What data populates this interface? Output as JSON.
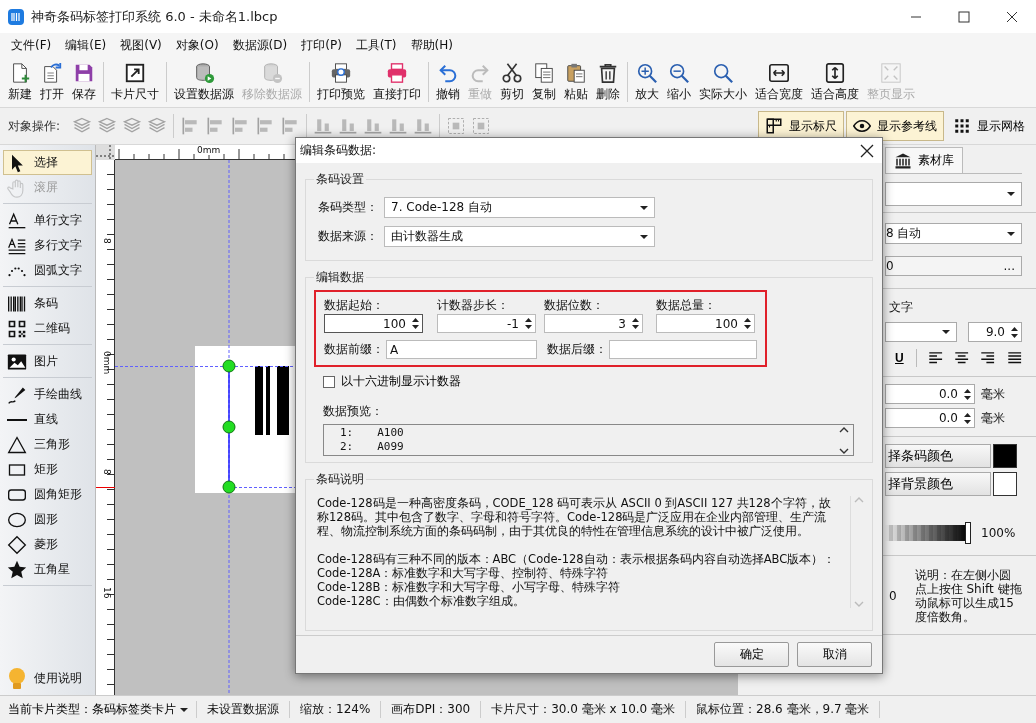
{
  "window": {
    "title": "神奇条码标签打印系统 6.0 - 未命名1.lbcp"
  },
  "menu": [
    "文件(F)",
    "编辑(E)",
    "视图(V)",
    "对象(O)",
    "数据源(D)",
    "打印(P)",
    "工具(T)",
    "帮助(H)"
  ],
  "toolbar": [
    [
      {
        "label": "新建",
        "disabled": false
      },
      {
        "label": "打开",
        "disabled": false
      },
      {
        "label": "保存",
        "disabled": false
      }
    ],
    [
      {
        "label": "卡片尺寸",
        "disabled": false
      }
    ],
    [
      {
        "label": "设置数据源",
        "disabled": false
      },
      {
        "label": "移除数据源",
        "disabled": true
      }
    ],
    [
      {
        "label": "打印预览",
        "disabled": false
      },
      {
        "label": "直接打印",
        "disabled": false
      }
    ],
    [
      {
        "label": "撤销",
        "disabled": false
      },
      {
        "label": "重做",
        "disabled": true
      },
      {
        "label": "剪切",
        "disabled": false
      },
      {
        "label": "复制",
        "disabled": false
      },
      {
        "label": "粘贴",
        "disabled": false
      },
      {
        "label": "删除",
        "disabled": false
      }
    ],
    [
      {
        "label": "放大",
        "disabled": false
      },
      {
        "label": "缩小",
        "disabled": false
      },
      {
        "label": "实际大小",
        "disabled": false
      },
      {
        "label": "适合宽度",
        "disabled": false
      },
      {
        "label": "适合高度",
        "disabled": false
      },
      {
        "label": "整页显示",
        "disabled": true
      }
    ]
  ],
  "object_toolbar": {
    "label": "对象操作:",
    "tools": [
      [
        {
          "disabled": true
        },
        {
          "disabled": true
        },
        {
          "disabled": true
        },
        {
          "disabled": true
        }
      ],
      [
        {
          "disabled": true
        },
        {
          "disabled": true
        },
        {
          "disabled": true
        },
        {
          "disabled": true
        },
        {
          "disabled": true
        }
      ],
      [
        {
          "disabled": true
        },
        {
          "disabled": true
        },
        {
          "disabled": true
        },
        {
          "disabled": true
        },
        {
          "disabled": true
        }
      ],
      [
        {
          "disabled": true
        },
        {
          "disabled": true
        }
      ]
    ],
    "toggles": [
      {
        "label": "显示标尺",
        "selected": true
      },
      {
        "label": "显示参考线",
        "selected": true
      },
      {
        "label": "显示网格",
        "selected": false
      }
    ]
  },
  "tools": {
    "groups": [
      [
        {
          "label": "选择",
          "selected": true,
          "disabled": false
        },
        {
          "label": "滚屏",
          "selected": false,
          "disabled": true
        }
      ],
      [
        {
          "label": "单行文字",
          "selected": false,
          "disabled": false
        },
        {
          "label": "多行文字",
          "selected": false,
          "disabled": false
        },
        {
          "label": "圆弧文字",
          "selected": false,
          "disabled": false
        }
      ],
      [
        {
          "label": "条码",
          "selected": false,
          "disabled": false
        },
        {
          "label": "二维码",
          "selected": false,
          "disabled": false
        }
      ],
      [
        {
          "label": "图片",
          "selected": false,
          "disabled": false
        }
      ],
      [
        {
          "label": "手绘曲线",
          "selected": false,
          "disabled": false
        },
        {
          "label": "直线",
          "selected": false,
          "disabled": false
        },
        {
          "label": "三角形",
          "selected": false,
          "disabled": false
        },
        {
          "label": "矩形",
          "selected": false,
          "disabled": false
        },
        {
          "label": "圆角矩形",
          "selected": false,
          "disabled": false
        },
        {
          "label": "圆形",
          "selected": false,
          "disabled": false
        },
        {
          "label": "菱形",
          "selected": false,
          "disabled": false
        },
        {
          "label": "五角星",
          "selected": false,
          "disabled": false
        }
      ]
    ],
    "help": "使用说明"
  },
  "canvas": {
    "top_ruler": [
      "0mm"
    ],
    "left_ruler": [
      "8",
      "0mm",
      "8",
      "16"
    ]
  },
  "right_panel": {
    "tab": "素材库",
    "barcode_type": "8 自动",
    "data": "0",
    "more_button": "...",
    "text_label": "文字",
    "font_size": "9.0",
    "underline": "U",
    "offsets": [
      {
        "value": "0.0",
        "unit": "毫米"
      },
      {
        "value": "0.0",
        "unit": "毫米"
      }
    ],
    "colors": [
      {
        "label": "择条码颜色",
        "color": "#000000"
      },
      {
        "label": "择背景颜色",
        "color": "#ffffff"
      }
    ],
    "opacity": {
      "level": 1,
      "reading": "100%"
    },
    "angle": "0",
    "note": "说明：在左侧小圆点上按住 Shift 键拖动鼠标可以生成15度倍数角。"
  },
  "dialog": {
    "title": "编辑条码数据:",
    "barcode_settings": {
      "title": "条码设置",
      "fields": [
        {
          "label": "条码类型：",
          "value": "7. Code-128 自动"
        },
        {
          "label": "数据来源：",
          "value": "由计数器生成"
        }
      ]
    },
    "edit_data": {
      "title": "编辑数据",
      "counters": [
        {
          "label": "数据起始：",
          "value": "100"
        },
        {
          "label": "计数器步长：",
          "value": "-1"
        },
        {
          "label": "数据位数：",
          "value": "3"
        },
        {
          "label": "数据总量：",
          "value": "100"
        }
      ],
      "affixes": [
        {
          "label": "数据前缀：",
          "value": "A"
        },
        {
          "label": "数据后缀："
        }
      ],
      "hex_checkbox": {
        "label": "以十六进制显示计数器",
        "checked": false
      },
      "preview": {
        "label": "数据预览：",
        "lines": [
          {
            "index": "1:",
            "value": "A100"
          },
          {
            "index": "2:",
            "value": "A099"
          }
        ]
      }
    },
    "description": {
      "title": "条码说明",
      "paragraphs": [
        {
          "lines": [
            "Code-128码是一种高密度条码，CODE_128 码可表示从 ASCII 0 到ASCII 127 共128个字符，故称128码。其中包含了数字、字母和符号字符。Code-128码是广泛应用在企业内部管理、生产流程、物流控制系统方面的条码码制，由于其优良的特性在管理信息系统的设计中被广泛使用。"
          ]
        },
        {
          "lines": [
            "Code-128码有三种不同的版本：ABC（Code-128自动：表示根据条码内容自动选择ABC版本）：",
            "Code-128A：标准数字和大写字母、控制符、特殊字符",
            "Code-128B：标准数字和大写字母、小写字母、特殊字符",
            "Code-128C：由偶数个标准数字组成。"
          ]
        }
      ]
    },
    "buttons": [
      "确定",
      "取消"
    ]
  },
  "status_bar": [
    {
      "kind": "dropdown",
      "text": "当前卡片类型：条码标签类卡片"
    },
    {
      "kind": "text",
      "text": "未设置数据源"
    },
    {
      "kind": "text",
      "text": "缩放：124%"
    },
    {
      "kind": "text",
      "text": "画布DPI：300"
    },
    {
      "kind": "text",
      "text": "卡片尺寸：30.0 毫米 x 10.0 毫米"
    },
    {
      "kind": "text",
      "text": "鼠标位置：28.6 毫米，9.7 毫米"
    }
  ]
}
